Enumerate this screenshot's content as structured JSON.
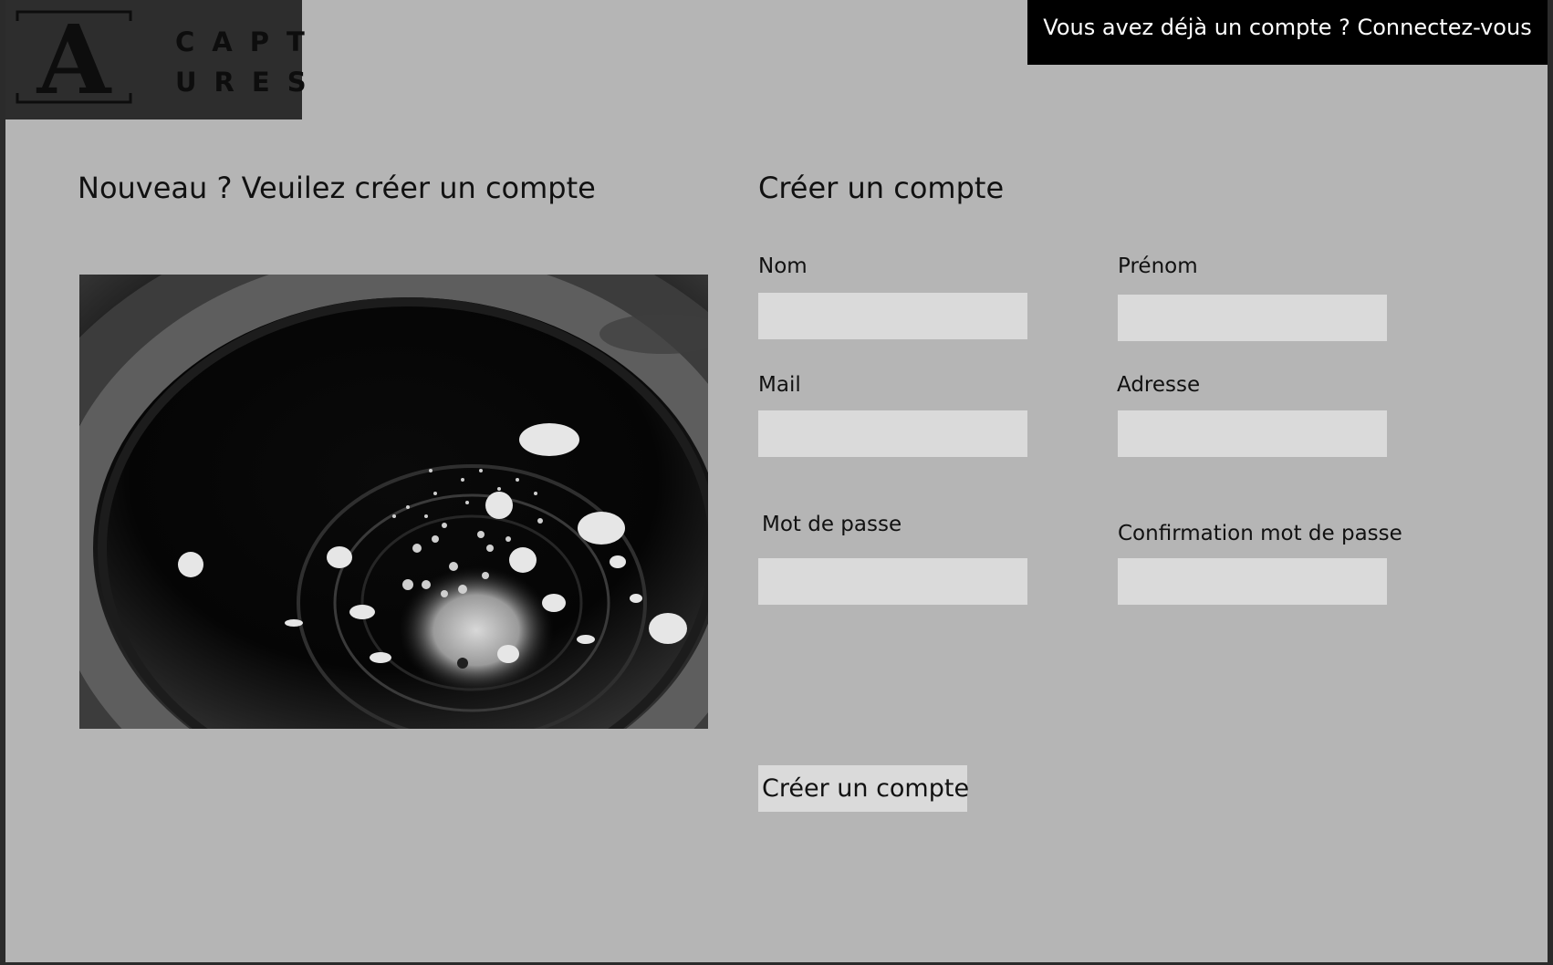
{
  "brand": {
    "logo_letter": "A",
    "logo_text_line1": "CAPT",
    "logo_text_line2": "URES"
  },
  "header": {
    "login_link": "Vous avez déjà un compte ? Connectez-vous"
  },
  "intro": {
    "title": "Nouveau ? Veuilez créer un compte"
  },
  "form": {
    "title": "Créer un compte",
    "fields": {
      "nom": {
        "label": "Nom",
        "value": ""
      },
      "prenom": {
        "label": "Prénom",
        "value": ""
      },
      "mail": {
        "label": "Mail",
        "value": ""
      },
      "adresse": {
        "label": "Adresse",
        "value": ""
      },
      "password": {
        "label": "Mot de passe",
        "value": ""
      },
      "password_confirm": {
        "label": "Confirmation mot de passe",
        "value": ""
      }
    },
    "submit_label": "Créer un compte"
  },
  "colors": {
    "page_background": "#b5b5b5",
    "input_background": "#dadada",
    "banner_background": "#000000",
    "logo_background": "#2d2d2d"
  }
}
